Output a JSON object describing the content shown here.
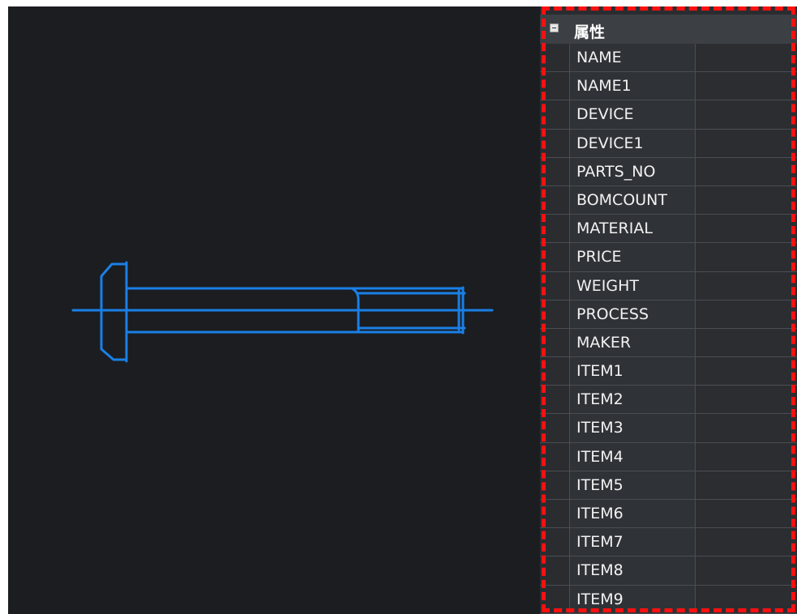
{
  "drawing": {
    "background": "#1b1d20",
    "stroke_color": "#1a7fe6",
    "object": "bolt"
  },
  "properties_panel": {
    "title": "属性",
    "collapse_icon": "minus-box-icon",
    "highlight_color": "#ff1010",
    "rows": [
      {
        "label": "NAME",
        "value": ""
      },
      {
        "label": "NAME1",
        "value": ""
      },
      {
        "label": "DEVICE",
        "value": ""
      },
      {
        "label": "DEVICE1",
        "value": ""
      },
      {
        "label": "PARTS_NO",
        "value": ""
      },
      {
        "label": "BOMCOUNT",
        "value": ""
      },
      {
        "label": "MATERIAL",
        "value": ""
      },
      {
        "label": "PRICE",
        "value": ""
      },
      {
        "label": "WEIGHT",
        "value": ""
      },
      {
        "label": "PROCESS",
        "value": ""
      },
      {
        "label": "MAKER",
        "value": ""
      },
      {
        "label": "ITEM1",
        "value": ""
      },
      {
        "label": "ITEM2",
        "value": ""
      },
      {
        "label": "ITEM3",
        "value": ""
      },
      {
        "label": "ITEM4",
        "value": ""
      },
      {
        "label": "ITEM5",
        "value": ""
      },
      {
        "label": "ITEM6",
        "value": ""
      },
      {
        "label": "ITEM7",
        "value": ""
      },
      {
        "label": "ITEM8",
        "value": ""
      },
      {
        "label": "ITEM9",
        "value": ""
      }
    ]
  }
}
